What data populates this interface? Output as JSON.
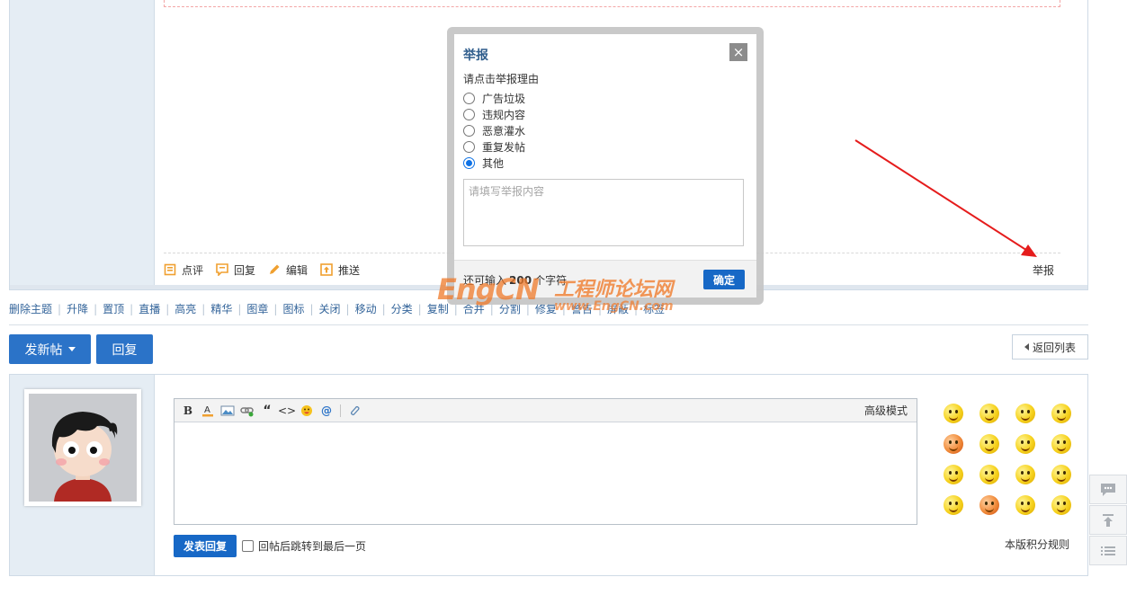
{
  "post_actions": [
    {
      "label": "点评",
      "color": "#f0a030"
    },
    {
      "label": "回复",
      "color": "#f0a030"
    },
    {
      "label": "编辑",
      "color": "#f0a030"
    },
    {
      "label": "推送",
      "color": "#f0a030"
    }
  ],
  "report_link": "举报",
  "moderation": {
    "items": [
      "删除主题",
      "升降",
      "置顶",
      "直播",
      "高亮",
      "精华",
      "图章",
      "图标",
      "关闭",
      "移动",
      "分类",
      "复制",
      "合并",
      "分割",
      "修复",
      "警告",
      "屏蔽",
      "标签"
    ]
  },
  "buttons": {
    "new_post": "发新帖",
    "reply": "回复",
    "back_list": "返回列表"
  },
  "editor": {
    "toolbar": {
      "bold": "B",
      "quote": "“",
      "code": "<>",
      "at": "@"
    },
    "advanced_mode": "高级模式",
    "submit": "发表回复",
    "jump_after_reply": "回帖后跳转到最后一页",
    "rules": "本版积分规则"
  },
  "report_dialog": {
    "title": "举报",
    "close": "×",
    "prompt": "请点击举报理由",
    "options": [
      {
        "label": "广告垃圾",
        "selected": false
      },
      {
        "label": "违规内容",
        "selected": false
      },
      {
        "label": "恶意灌水",
        "selected": false
      },
      {
        "label": "重复发帖",
        "selected": false
      },
      {
        "label": "其他",
        "selected": true
      }
    ],
    "placeholder": "请填写举报内容",
    "remain_prefix": "还可输入",
    "remain_count": "200",
    "remain_suffix": "个字符",
    "confirm": "确定"
  },
  "watermark": {
    "latin": "EngCN",
    "cn": "工程师论坛网",
    "url": "www.EngCN.com"
  },
  "colors": {
    "primary": "#2b73c8",
    "sidebar": "#e5edf4",
    "annotation_arrow": "#e51c1c",
    "watermark": "#f07a2a"
  }
}
